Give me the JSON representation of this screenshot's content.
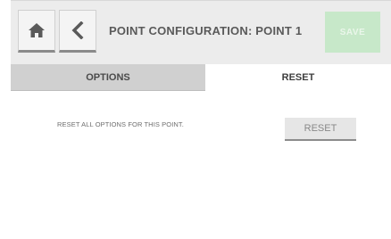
{
  "header": {
    "title": "POINT CONFIGURATION: POINT 1",
    "home_icon": "home-icon",
    "back_icon": "chevron-left-icon",
    "save_label": "SAVE",
    "save_color": "#c7e8c9"
  },
  "tabs": [
    {
      "label": "OPTIONS",
      "active": false
    },
    {
      "label": "RESET",
      "active": true
    }
  ],
  "reset_section": {
    "description": "RESET ALL OPTIONS FOR THIS POINT.",
    "button_label": "RESET"
  },
  "colors": {
    "header_bg": "#ececec",
    "inactive_tab_bg": "#d0d0d0",
    "active_tab_bg": "#ffffff"
  }
}
